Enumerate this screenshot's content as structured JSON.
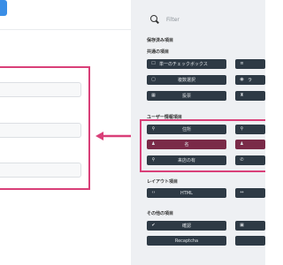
{
  "search": {
    "placeholder": "Filter",
    "icon": "search-icon"
  },
  "form": {
    "field_count": 3
  },
  "sections": {
    "saved": {
      "title": "保存済み項目"
    },
    "common": {
      "title": "共通の項目",
      "items": [
        {
          "label": "単一のチェックボックス",
          "icon": "checkbox-icon"
        },
        {
          "label": "",
          "icon": "list-icon"
        },
        {
          "label": "複数選択",
          "icon": "square-icon"
        },
        {
          "label": "ラ",
          "icon": "radio-icon"
        },
        {
          "label": "投票",
          "icon": "grid-icon"
        },
        {
          "label": "",
          "icon": "trophy-icon"
        }
      ]
    },
    "user": {
      "title": "ユーザー情報項目",
      "items": [
        {
          "label": "住所",
          "icon": "map-pin-icon"
        },
        {
          "label": "",
          "icon": "map-pin-icon"
        },
        {
          "label": "名",
          "icon": "user-icon"
        },
        {
          "label": "",
          "icon": "user-icon"
        },
        {
          "label": "来店の有",
          "icon": "map-pin-icon"
        },
        {
          "label": "",
          "icon": "phone-icon"
        }
      ]
    },
    "layout": {
      "title": "レイアウト項目",
      "items": [
        {
          "label": "HTML",
          "icon": "code-icon"
        },
        {
          "label": "",
          "icon": "resize-icon"
        }
      ]
    },
    "other": {
      "title": "その他の項目",
      "items": [
        {
          "label": "確認",
          "icon": "check-circle-icon"
        },
        {
          "label": "",
          "icon": "image-icon"
        },
        {
          "label": "Recaptcha",
          "icon": ""
        },
        {
          "label": "",
          "icon": ""
        }
      ]
    }
  },
  "colors": {
    "accent": "#3a8ee6",
    "highlight": "#d93f78",
    "button_bg": "#2e3a45",
    "panel_bg": "#eef0f3"
  }
}
